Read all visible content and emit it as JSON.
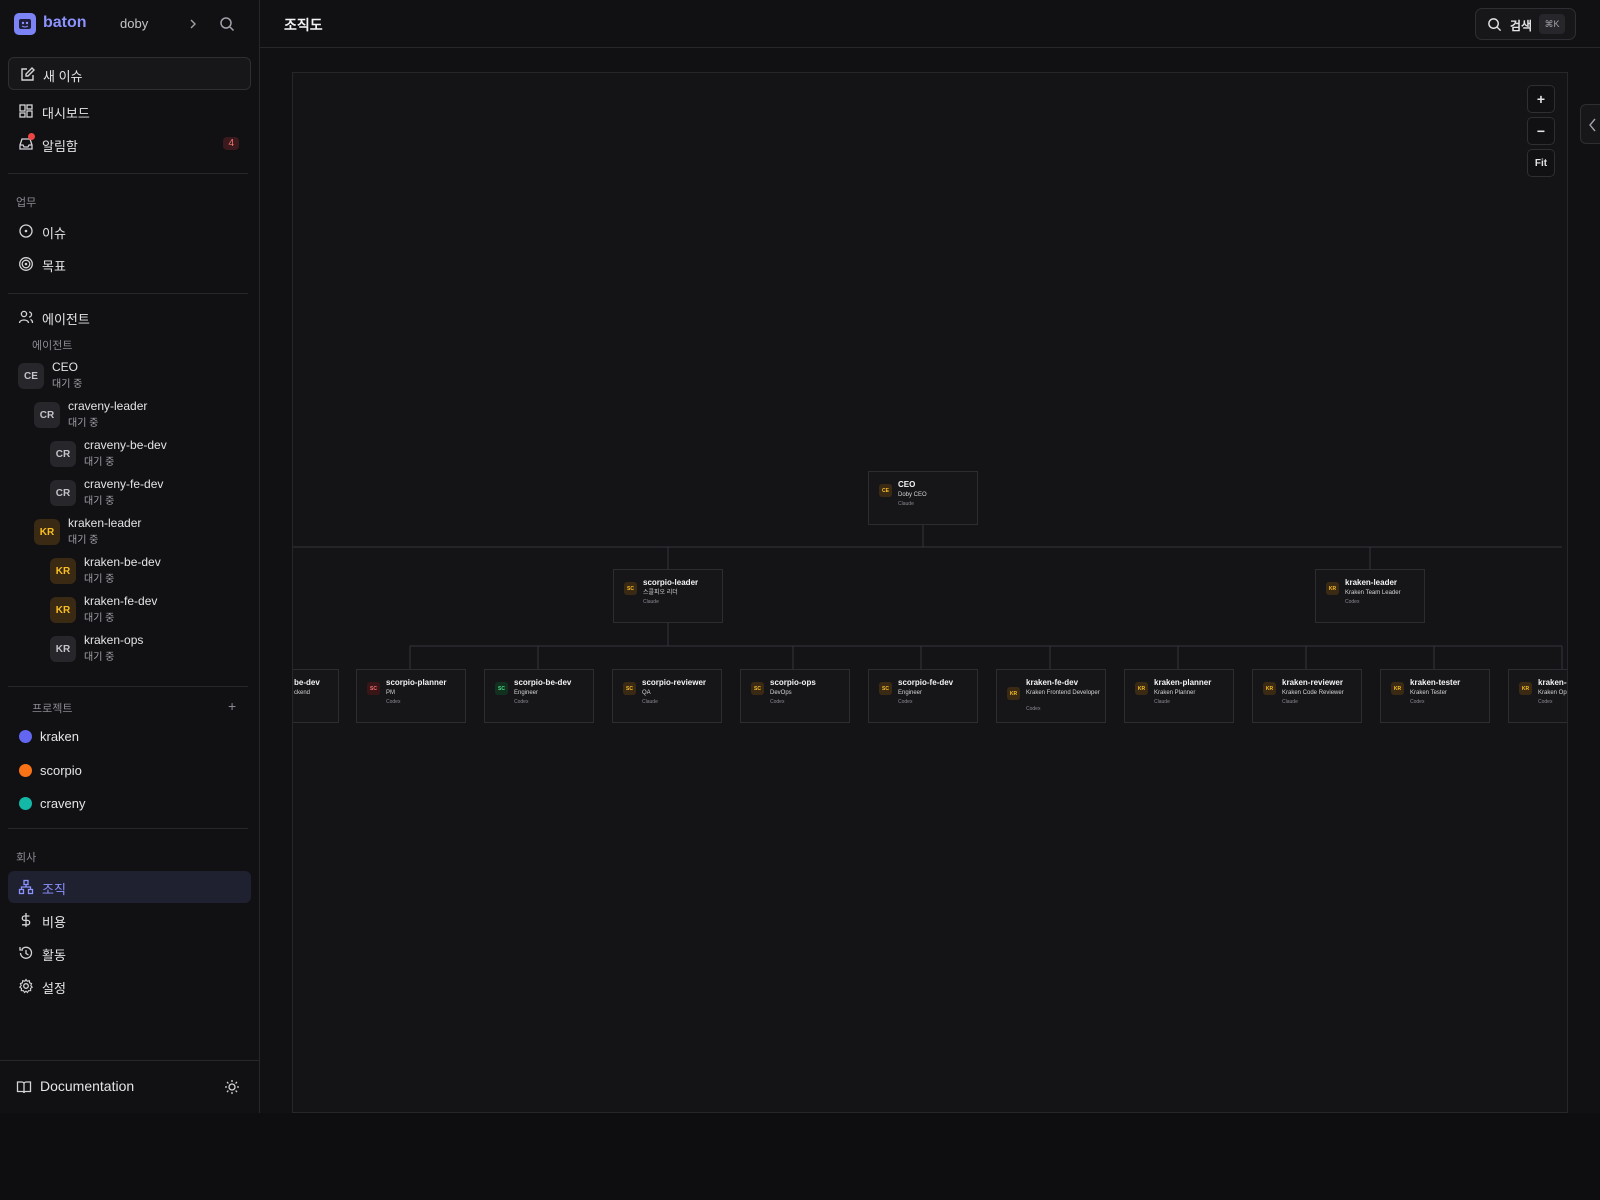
{
  "app": {
    "name": "baton",
    "company": "doby"
  },
  "sidebar": {
    "new_issue": "새 이슈",
    "dashboard": "대시보드",
    "inbox": "알림함",
    "inbox_count": "4",
    "work_section": "업무",
    "issues": "이슈",
    "goals": "목표",
    "agents": "에이전트",
    "agents_sub": "에이전트",
    "agent_list": [
      {
        "initials": "CE",
        "name": "CEO",
        "status": "대기 중"
      },
      {
        "initials": "CR",
        "name": "craveny-leader",
        "status": "대기 중"
      },
      {
        "initials": "CR",
        "name": "craveny-be-dev",
        "status": "대기 중"
      },
      {
        "initials": "CR",
        "name": "craveny-fe-dev",
        "status": "대기 중"
      },
      {
        "initials": "KR",
        "name": "kraken-leader",
        "status": "대기 중"
      },
      {
        "initials": "KR",
        "name": "kraken-be-dev",
        "status": "대기 중"
      },
      {
        "initials": "KR",
        "name": "kraken-fe-dev",
        "status": "대기 중"
      },
      {
        "initials": "KR",
        "name": "kraken-ops",
        "status": "대기 중"
      }
    ],
    "projects_section": "프로젝트",
    "projects": [
      {
        "name": "kraken",
        "color": "#6366f1"
      },
      {
        "name": "scorpio",
        "color": "#f97316"
      },
      {
        "name": "craveny",
        "color": "#14b8a6"
      }
    ],
    "company_section": "회사",
    "org": "조직",
    "costs": "비용",
    "activity": "활동",
    "settings": "설정",
    "docs": "Documentation"
  },
  "header": {
    "title": "조직도",
    "search_label": "검색",
    "search_shortcut": "⌘K"
  },
  "zoom": {
    "in": "+",
    "out": "−",
    "fit": "Fit"
  },
  "org": {
    "ceo": {
      "initials": "CE",
      "name": "CEO",
      "role": "Doby CEO",
      "provider": "Claude"
    },
    "scorpio_leader": {
      "initials": "SC",
      "name": "scorpio-leader",
      "role": "스콜피오 리더",
      "provider": "Claude"
    },
    "kraken_leader": {
      "initials": "KR",
      "name": "kraken-leader",
      "role": "Kraken Team Leader",
      "provider": "Codex"
    },
    "row": [
      {
        "initials": "",
        "name": "be-dev",
        "role": "ckend",
        "provider": ""
      },
      {
        "initials": "SC",
        "name": "scorpio-planner",
        "role": "PM",
        "provider": "Codex"
      },
      {
        "initials": "SC",
        "name": "scorpio-be-dev",
        "role": "Engineer",
        "provider": "Codex"
      },
      {
        "initials": "SC",
        "name": "scorpio-reviewer",
        "role": "QA",
        "provider": "Claude"
      },
      {
        "initials": "SC",
        "name": "scorpio-ops",
        "role": "DevOps",
        "provider": "Codex"
      },
      {
        "initials": "SC",
        "name": "scorpio-fe-dev",
        "role": "Engineer",
        "provider": "Codex"
      },
      {
        "initials": "KR",
        "name": "kraken-fe-dev",
        "role": "Kraken Frontend Developer",
        "provider": "Codex"
      },
      {
        "initials": "KR",
        "name": "kraken-planner",
        "role": "Kraken Planner",
        "provider": "Claude"
      },
      {
        "initials": "KR",
        "name": "kraken-reviewer",
        "role": "Kraken Code Reviewer",
        "provider": "Claude"
      },
      {
        "initials": "KR",
        "name": "kraken-tester",
        "role": "Kraken Tester",
        "provider": "Codex"
      },
      {
        "initials": "KR",
        "name": "kraken-d",
        "role": "Kraken Ops",
        "provider": "Codex"
      }
    ]
  }
}
